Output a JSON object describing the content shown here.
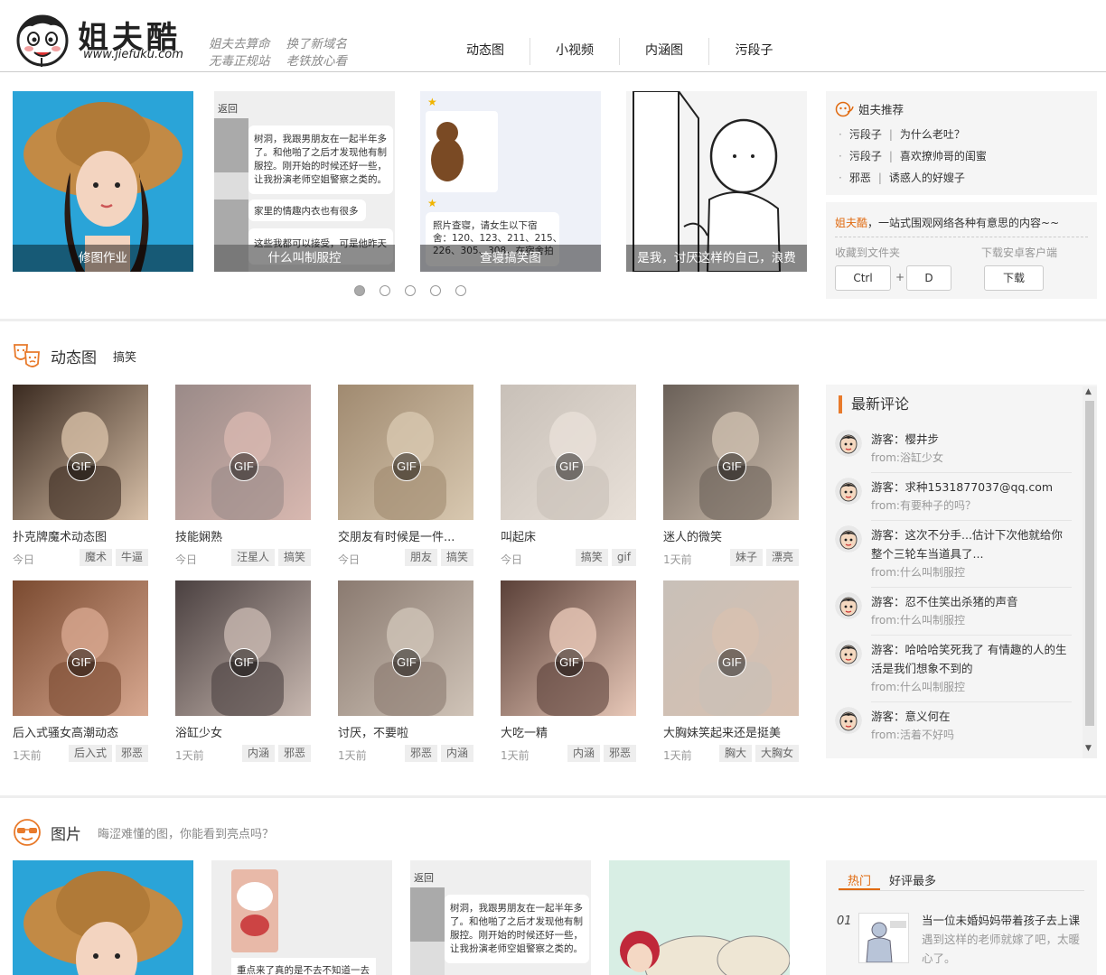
{
  "header": {
    "logo_text": "姐夫酷",
    "logo_url": "www.jiefuku.com",
    "slogan_line1": [
      "姐夫去算命",
      "换了新域名"
    ],
    "slogan_line2": [
      "无毒正规站",
      "老铁放心看"
    ],
    "nav": [
      "动态图",
      "小视频",
      "内涵图",
      "污段子"
    ]
  },
  "slider": {
    "slides": [
      "修图作业",
      "什么叫制服控",
      "查寝搞笑图",
      "是我，讨厌这样的自己，浪费"
    ],
    "chat_lines": [
      "树洞，我跟男朋友在一起半年多了。和他啪了之后才发现他有制服控。刚开始的时候还好一些，让我扮演老师空姐警察之类的。",
      "家里的情趣内衣也有很多",
      "这些我都可以接受，可是他昨天突然"
    ],
    "back_label": "返回",
    "dorm_text": "照片查寝，请女生以下宿舍：120、123、211、215、226、305、308，在宿舍拍集体照给我",
    "dots": 5,
    "active_dot": 0
  },
  "recommend": {
    "title": "姐夫推荐",
    "items": [
      {
        "cat": "污段子",
        "title": "为什么老吐？"
      },
      {
        "cat": "污段子",
        "title": "喜欢撩帅哥的闺蜜"
      },
      {
        "cat": "邪恶",
        "title": "诱惑人的好嫂子"
      }
    ],
    "sep": "|"
  },
  "intro": {
    "brand": "姐夫酷",
    "text": "，一站式围观网络各种有意思的内容~~",
    "fav_label": "收藏到文件夹",
    "dl_label": "下载安卓客户端",
    "key1": "Ctrl",
    "plus": "+",
    "key2": "D",
    "download": "下载"
  },
  "gif_section": {
    "title": "动态图",
    "tag": "搞笑",
    "badge": "GIF",
    "cards": [
      {
        "title": "扑克牌魔术动态图",
        "time": "今日",
        "tags": [
          "魔术",
          "牛逼"
        ]
      },
      {
        "title": "技能娴熟",
        "time": "今日",
        "tags": [
          "汪星人",
          "搞笑"
        ]
      },
      {
        "title": "交朋友有时候是一件...",
        "time": "今日",
        "tags": [
          "朋友",
          "搞笑"
        ]
      },
      {
        "title": "叫起床",
        "time": "今日",
        "tags": [
          "搞笑",
          "gif"
        ]
      },
      {
        "title": "迷人的微笑",
        "time": "1天前",
        "tags": [
          "妹子",
          "漂亮"
        ]
      },
      {
        "title": "后入式骚女高潮动态",
        "time": "1天前",
        "tags": [
          "后入式",
          "邪恶"
        ]
      },
      {
        "title": "浴缸少女",
        "time": "1天前",
        "tags": [
          "内涵",
          "邪恶"
        ]
      },
      {
        "title": "讨厌，不要啦",
        "time": "1天前",
        "tags": [
          "邪恶",
          "内涵"
        ]
      },
      {
        "title": "大吃一精",
        "time": "1天前",
        "tags": [
          "内涵",
          "邪恶"
        ]
      },
      {
        "title": "大胸妹笑起来还是挺美",
        "time": "1天前",
        "tags": [
          "胸大",
          "大胸女"
        ]
      }
    ]
  },
  "comments": {
    "title": "最新评论",
    "items": [
      {
        "text": "游客：樱井步",
        "from": "from:浴缸少女"
      },
      {
        "text": "游客：求种1531877037@qq.com",
        "from": "from:有要种子的吗？"
      },
      {
        "text": "游客：这次不分手...估计下次他就给你整个三轮车当道具了...",
        "from": "from:什么叫制服控"
      },
      {
        "text": "游客：忍不住笑出杀猪的声音",
        "from": "from:什么叫制服控"
      },
      {
        "text": "游客：哈哈哈笑死我了 有情趣的人的生活是我们想象不到的",
        "from": "from:什么叫制服控"
      },
      {
        "text": "游客：意义何在",
        "from": "from:活着不好吗"
      }
    ]
  },
  "pic_section": {
    "title": "图片",
    "sub": "晦涩难懂的图，你能看到亮点吗？",
    "pic2_caption": "重点来了真的是不去不知道一去"
  },
  "hot": {
    "tabs": [
      "热门",
      "好评最多"
    ],
    "num": "01",
    "text_main": "当一位未婚妈妈带着孩子去上课",
    "text_gray": "遇到这样的老师就嫁了吧，太暖心了。"
  },
  "colors": {
    "accent": "#e06a10",
    "panel": "#f5f5f5"
  }
}
